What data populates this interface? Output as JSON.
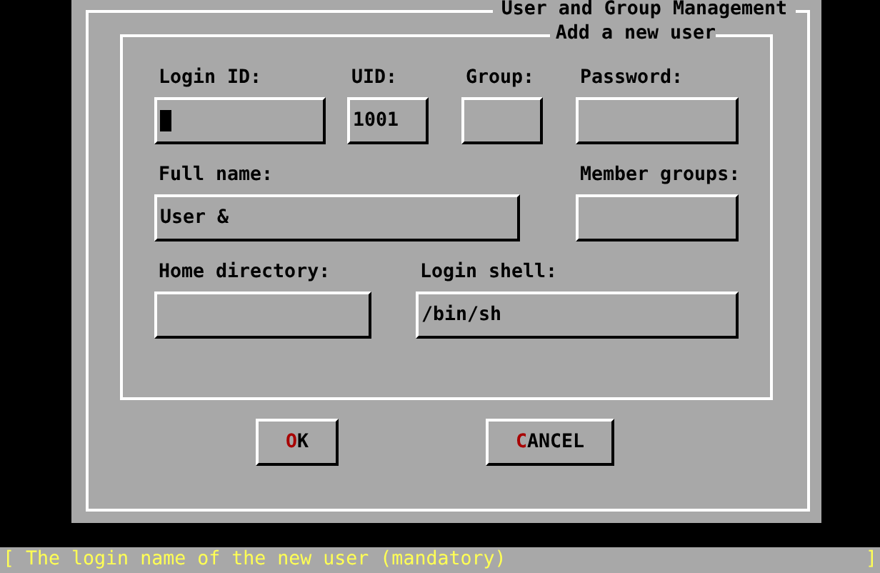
{
  "dialog": {
    "title": "User and Group Management"
  },
  "form": {
    "title": "Add a new user",
    "fields": [
      {
        "label": "Login ID:",
        "focused": true
      },
      {
        "label": "UID:",
        "value": "1001",
        "focused": false
      },
      {
        "label": "Group:",
        "focused": false
      },
      {
        "label": "Password:",
        "focused": false
      },
      {
        "label": "Full name:",
        "value": "User &",
        "focused": false
      },
      {
        "label": "Member groups:",
        "focused": false
      },
      {
        "label": "Home directory:",
        "focused": false
      },
      {
        "label": "Login shell:",
        "value": "/bin/sh",
        "focused": false
      }
    ]
  },
  "buttons": [
    {
      "hotkey": "O",
      "rest": "K",
      "selected": false
    },
    {
      "hotkey": "C",
      "rest": "ANCEL",
      "selected": false
    }
  ],
  "status_bar": {
    "text": "[ The login name of the new user (mandatory)",
    "end": "]"
  }
}
